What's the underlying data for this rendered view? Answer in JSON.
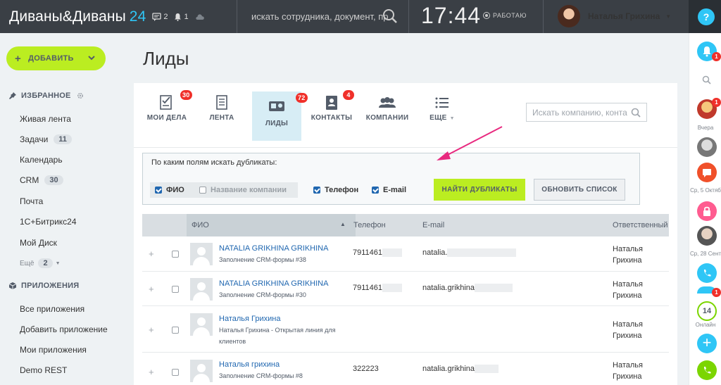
{
  "topbar": {
    "logo_main": "Диваны&Диваны",
    "logo_num": "24",
    "messages_count": "2",
    "notifications_count": "1",
    "search_placeholder": "искать сотрудника, документ, пр",
    "clock": "17:44",
    "work_status": "РАБОТАЮ",
    "user_name": "Наталья Грихина",
    "help_label": "?"
  },
  "sidebar": {
    "add_label": "ДОБАВИТЬ",
    "favorites_title": "ИЗБРАННОЕ",
    "favorites": [
      {
        "label": "Живая лента",
        "count": null
      },
      {
        "label": "Задачи",
        "count": "11"
      },
      {
        "label": "Календарь",
        "count": null
      },
      {
        "label": "CRM",
        "count": "30"
      },
      {
        "label": "Почта",
        "count": null
      },
      {
        "label": "1С+Битрикс24",
        "count": null
      },
      {
        "label": "Мой Диск",
        "count": null
      }
    ],
    "more_label": "Ещё",
    "more_count": "2",
    "apps_title": "ПРИЛОЖЕНИЯ",
    "apps": [
      {
        "label": "Все приложения"
      },
      {
        "label": "Добавить приложение"
      },
      {
        "label": "Мои приложения"
      },
      {
        "label": "Demo REST"
      }
    ]
  },
  "page": {
    "title": "Лиды",
    "tabs": [
      {
        "label": "МОИ ДЕЛА",
        "badge": "30"
      },
      {
        "label": "ЛЕНТА",
        "badge": null
      },
      {
        "label": "ЛИДЫ",
        "badge": "72"
      },
      {
        "label": "КОНТАКТЫ",
        "badge": "4"
      },
      {
        "label": "КОМПАНИИ",
        "badge": null
      },
      {
        "label": "ЕЩЕ",
        "badge": null
      }
    ],
    "search_placeholder": "Искать компанию, конта"
  },
  "duplicates": {
    "title": "По каким полям искать дубликаты:",
    "fields": [
      {
        "label": "ФИО",
        "checked": true
      },
      {
        "label": "Название компании",
        "checked": false
      },
      {
        "label": "Телефон",
        "checked": true
      },
      {
        "label": "E-mail",
        "checked": true
      }
    ],
    "find_button": "НАЙТИ ДУБЛИКАТЫ",
    "refresh_button": "ОБНОВИТЬ СПИСОК"
  },
  "table": {
    "columns": [
      "ФИО",
      "Телефон",
      "E-mail",
      "Ответственный"
    ],
    "rows": [
      {
        "name": "NATALIA GRIKHINA GRIKHINA",
        "source": "Заполнение CRM-формы #38",
        "phone": "7911461",
        "email": "natalia.",
        "responsible": [
          "Наталья",
          "Грихина"
        ]
      },
      {
        "name": "NATALIA GRIKHINA GRIKHINA",
        "source": "Заполнение CRM-формы #30",
        "phone": "7911461",
        "email": "natalia.grikhina",
        "responsible": [
          "Наталья",
          "Грихина"
        ]
      },
      {
        "name": "Наталья Грихина",
        "source": "Наталья Грихина - Открытая линия для клиентов",
        "phone": "",
        "email": "",
        "responsible": [
          "Наталья",
          "Грихина"
        ]
      },
      {
        "name": "Наталья грихина",
        "source": "Заполнение CRM-формы #8",
        "phone": "322223",
        "email": "natalia.grikhina",
        "responsible": [
          "Наталья",
          "Грихина"
        ]
      }
    ]
  },
  "right_bar": {
    "label_yesterday": "Вчера",
    "label_oct5": "Ср, 5 Октяб",
    "label_sep28": "Ср, 28 Сент",
    "online_count": "14",
    "online_label": "Онлайн",
    "badge_1": "1",
    "badge_2": "1",
    "badge_3": "1",
    "colors": {
      "accent": "#2fc6f6",
      "red": "#f0302a",
      "green": "#7bd500",
      "pink": "#ff5c90"
    }
  }
}
